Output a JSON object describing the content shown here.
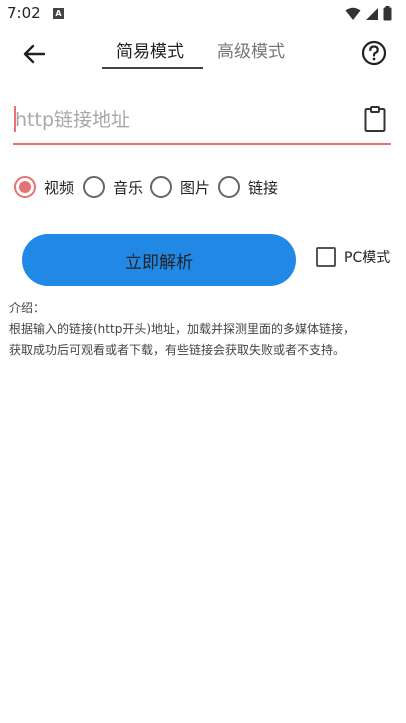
{
  "status_bar": {
    "time": "7:02",
    "notification_glyph": "A"
  },
  "tabs": [
    {
      "label": "简易模式",
      "active": true
    },
    {
      "label": "高级模式",
      "active": false
    }
  ],
  "url_input": {
    "placeholder": "http链接地址",
    "value": ""
  },
  "media_types": [
    {
      "label": "视频",
      "checked": true
    },
    {
      "label": "音乐",
      "checked": false
    },
    {
      "label": "图片",
      "checked": false
    },
    {
      "label": "链接",
      "checked": false
    }
  ],
  "parse_button": {
    "label": "立即解析"
  },
  "pc_mode": {
    "label": "PC模式",
    "checked": false
  },
  "intro": {
    "heading": "介绍：",
    "line1": "根据输入的链接(http开头)地址，加载并探测里面的多媒体链接，",
    "line2": "获取成功后可观看或者下载，有些链接会获取失败或者不支持。"
  },
  "colors": {
    "accent": "#e57373",
    "button": "#2188e5"
  }
}
